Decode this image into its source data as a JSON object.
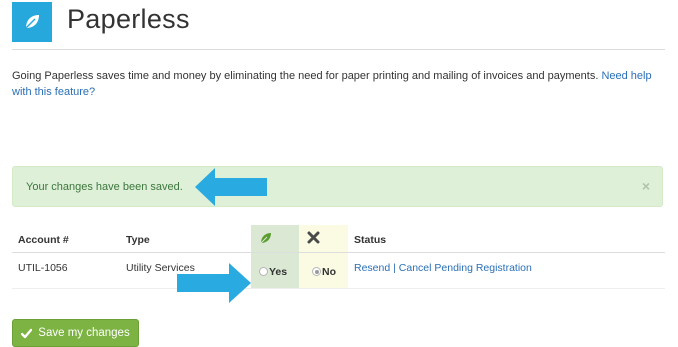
{
  "page": {
    "title": "Paperless",
    "intro_text": "Going Paperless saves time and money by eliminating the need for paper printing and mailing of invoices and payments. ",
    "help_link": "Need help with this feature?"
  },
  "alert": {
    "message": "Your changes have been saved.",
    "close": "×"
  },
  "table": {
    "headers": {
      "account": "Account #",
      "type": "Type",
      "status": "Status"
    },
    "rows": [
      {
        "account": "UTIL-1056",
        "type": "Utility Services",
        "paperless_yes_label": "Yes",
        "paperless_no_label": "No",
        "selected": "No",
        "status_links": [
          "Resend",
          "Cancel Pending Registration"
        ],
        "status_separator": "|"
      }
    ]
  },
  "buttons": {
    "save": "Save my changes"
  },
  "colors": {
    "brand_blue": "#27a8dc",
    "success_bg": "#dff0d8",
    "success_text": "#3c763d",
    "button_green": "#7cb342",
    "annotation_arrow": "#29abe2",
    "link": "#2a6fb6"
  },
  "icons": {
    "logo": "leaf-icon",
    "paperless_column": "leaf-icon",
    "paper_column": "x-icon",
    "save_button": "checkmark-icon",
    "annotation": "arrow-icon"
  }
}
